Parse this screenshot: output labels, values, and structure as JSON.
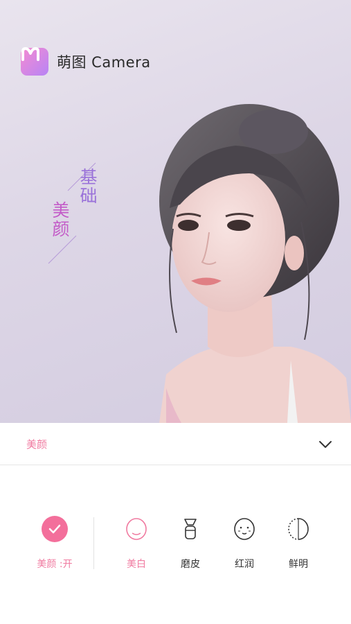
{
  "app": {
    "name": "萌图 Camera"
  },
  "photo": {
    "tag_line1": "基础",
    "tag_line2": "美颜"
  },
  "panel": {
    "title": "美颜",
    "toggle": {
      "label": "美颜 :开",
      "on": true
    },
    "options": [
      {
        "label": "美白",
        "icon": "face-whiten-icon",
        "active": true
      },
      {
        "label": "磨皮",
        "icon": "smooth-skin-brush-icon",
        "active": false
      },
      {
        "label": "红润",
        "icon": "rosy-face-icon",
        "active": false
      },
      {
        "label": "鲜明",
        "icon": "vivid-half-face-icon",
        "active": false
      }
    ]
  },
  "colors": {
    "accent": "#f36f9b",
    "accent_text": "#f07aa0",
    "purple": "#9a72d9"
  }
}
